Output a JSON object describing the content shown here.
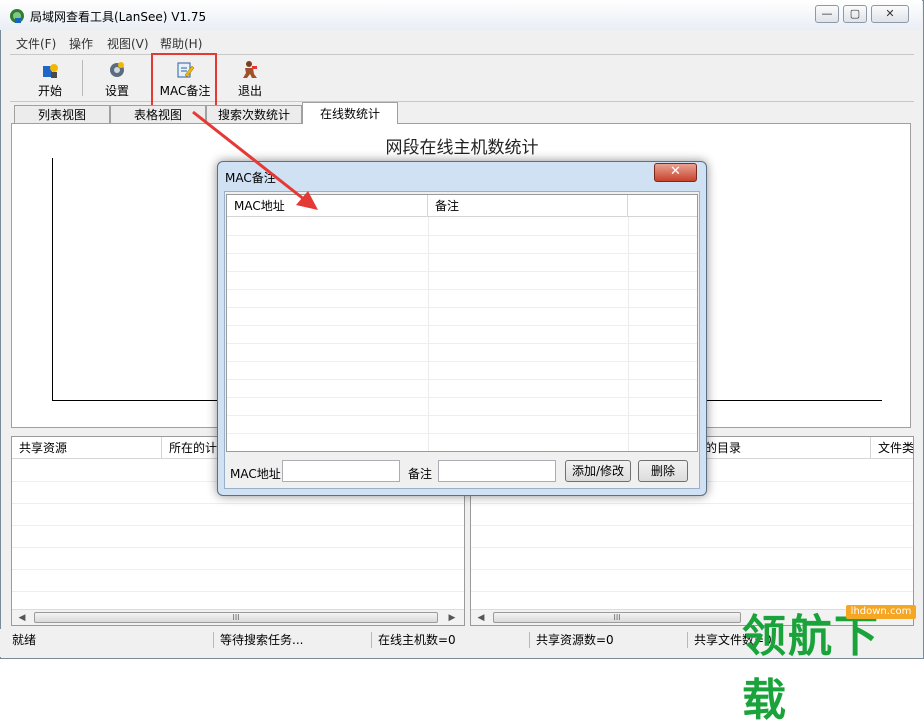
{
  "window": {
    "title": "局域网查看工具(LanSee) V1.75",
    "minimize_glyph": "—",
    "restore_glyph": "▢",
    "close_glyph": "✕"
  },
  "menu": [
    "文件(F)",
    "操作",
    "视图(V)",
    "帮助(H)"
  ],
  "toolbar": {
    "start_label": "开始",
    "settings_label": "设置",
    "mac_label": "MAC备注",
    "exit_label": "退出"
  },
  "tabs": [
    "列表视图",
    "表格视图",
    "搜索次数统计",
    "在线数统计"
  ],
  "active_tab": "在线数统计",
  "chart": {
    "title": "网段在线主机数统计"
  },
  "left_list": {
    "columns": [
      "共享资源",
      "所在的计"
    ]
  },
  "right_list": {
    "columns": [
      "的目录",
      "文件类"
    ]
  },
  "scroll": {
    "left_arrow": "◀",
    "right_arrow": "▶",
    "thumb_grip": "III"
  },
  "status": [
    "就绪",
    "等待搜索任务...",
    "在线主机数=0",
    "共享资源数=0",
    "共享文件数=0"
  ],
  "watermark": {
    "text": "领航下载",
    "site": "lhdown.com"
  },
  "dialog": {
    "title": "MAC备注",
    "close_glyph": "✕",
    "columns": [
      "MAC地址",
      "备注"
    ],
    "mac_label": "MAC地址",
    "mac_value": "",
    "note_label": "备注",
    "note_value": "",
    "add_button": "添加/修改",
    "delete_button": "删除"
  },
  "colors": {
    "highlight": "#e53935",
    "watermark": "#19a33a"
  }
}
